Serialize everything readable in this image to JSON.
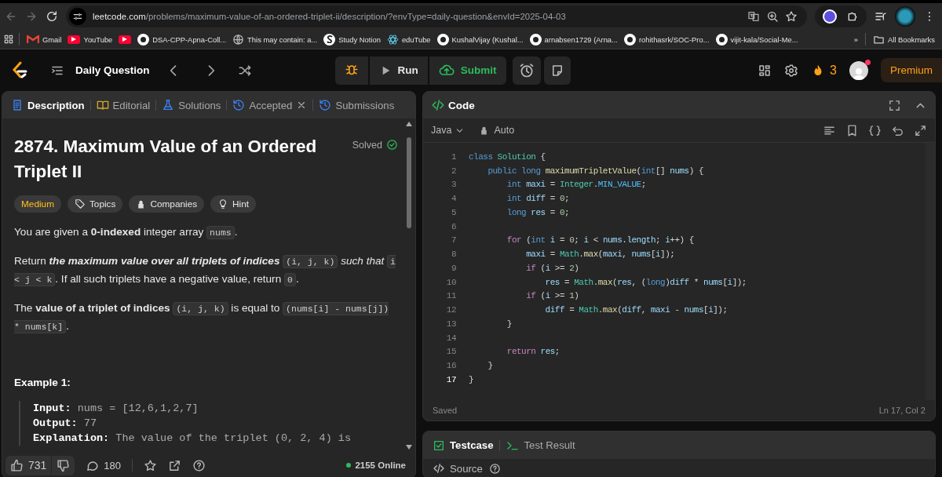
{
  "browser": {
    "url_host": "leetcode.com",
    "url_path": "/problems/maximum-value-of-an-ordered-triplet-ii/description/?envType=daily-question&envId=2025-04-03"
  },
  "bookmarks": [
    {
      "kind": "gmail",
      "label": "Gmail"
    },
    {
      "kind": "youtube",
      "label": "YouTube"
    },
    {
      "kind": "youtube"
    },
    {
      "kind": "github",
      "label": "DSA-CPP-Apna-Coll..."
    },
    {
      "kind": "globe",
      "label": "This may contain: a..."
    },
    {
      "kind": "notion",
      "label": "Study Notion"
    },
    {
      "kind": "react",
      "label": "eduTube"
    },
    {
      "kind": "github",
      "label": "KushalVijay (Kushal..."
    },
    {
      "kind": "github",
      "label": "arnabsen1729 (Arna..."
    },
    {
      "kind": "github",
      "label": "rohithasrk/SOC-Pro..."
    },
    {
      "kind": "github",
      "label": "vijit-kala/Social-Me..."
    }
  ],
  "more_bookmarks": "»",
  "all_bookmarks": "All Bookmarks",
  "nav": {
    "title": "Daily Question",
    "run": "Run",
    "submit": "Submit",
    "streak": "3",
    "premium": "Premium"
  },
  "left_tabs": [
    {
      "kind": "description",
      "label": "Description",
      "selected": true,
      "closable": false
    },
    {
      "kind": "editorial",
      "label": "Editorial",
      "selected": false,
      "closable": false
    },
    {
      "kind": "solutions",
      "label": "Solutions",
      "selected": false,
      "closable": false
    },
    {
      "kind": "history",
      "label": "Accepted",
      "selected": false,
      "closable": true
    },
    {
      "kind": "history",
      "label": "Submissions",
      "selected": false,
      "closable": false
    }
  ],
  "problem": {
    "title": "2874. Maximum Value of an Ordered Triplet II",
    "status": "Solved",
    "difficulty": "Medium",
    "tags": [
      {
        "kind": "topics",
        "label": "Topics"
      },
      {
        "kind": "companies",
        "label": "Companies"
      },
      {
        "kind": "hint",
        "label": "Hint"
      }
    ],
    "paragraphs": [
      [
        {
          "kind": "text",
          "text": "You are given a **0-indexed** integer array "
        },
        {
          "kind": "code",
          "text": "nums"
        },
        {
          "kind": "text",
          "text": "."
        }
      ],
      [
        {
          "kind": "text",
          "text": "Return "
        },
        {
          "kind": "emph",
          "text": "the maximum value over all triplets of indices "
        },
        {
          "kind": "code",
          "text": "(i, j, k)"
        },
        {
          "kind": "italic",
          "text": " such that "
        },
        {
          "kind": "code",
          "text": "i < j < k"
        },
        {
          "kind": "text",
          "text": ". If all such triplets have a negative value, return "
        },
        {
          "kind": "code",
          "text": "0"
        },
        {
          "kind": "text",
          "text": "."
        }
      ],
      [
        {
          "kind": "text",
          "text": "The **value of a triplet of indices** "
        },
        {
          "kind": "code",
          "text": "(i, j, k)"
        },
        {
          "kind": "text",
          "text": " is equal to "
        },
        {
          "kind": "code",
          "text": "(nums[i] - nums[j]) * nums[k]"
        },
        {
          "kind": "text",
          "text": "."
        }
      ]
    ],
    "example_title": "Example 1:",
    "example_lines": [
      {
        "label": "Input:",
        "value": "nums = [12,6,1,2,7]"
      },
      {
        "label": "Output:",
        "value": "77"
      },
      {
        "label": "Explanation:",
        "value": "The value of the triplet (0, 2, 4) is"
      }
    ]
  },
  "footer": {
    "likes": "731",
    "comments": "180",
    "online": "2155 Online"
  },
  "code_panel": {
    "title": "Code",
    "language": "Java",
    "mode": "Auto",
    "lines": [
      {
        "number": "1",
        "selected": false,
        "tokens": [
          {
            "text": "class ",
            "kind": "kw"
          },
          {
            "text": "Solution",
            "kind": "type"
          },
          {
            "text": " {",
            "kind": "p"
          }
        ]
      },
      {
        "number": "2",
        "selected": false,
        "tokens": [
          {
            "text": "    public long ",
            "kind": "kw"
          },
          {
            "text": "maximumTripletValue",
            "kind": "fn"
          },
          {
            "text": "(",
            "kind": "p"
          },
          {
            "text": "int",
            "kind": "kw"
          },
          {
            "text": "[] ",
            "kind": "p"
          },
          {
            "text": "nums",
            "kind": "var"
          },
          {
            "text": ") {",
            "kind": "p"
          }
        ]
      },
      {
        "number": "3",
        "selected": false,
        "tokens": [
          {
            "text": "        int ",
            "kind": "kw"
          },
          {
            "text": "maxi",
            "kind": "var"
          },
          {
            "text": " = ",
            "kind": "p"
          },
          {
            "text": "Integer",
            "kind": "type"
          },
          {
            "text": ".",
            "kind": "p"
          },
          {
            "text": "MIN_VALUE",
            "kind": "const"
          },
          {
            "text": ";",
            "kind": "p"
          }
        ]
      },
      {
        "number": "4",
        "selected": false,
        "tokens": [
          {
            "text": "        int ",
            "kind": "kw"
          },
          {
            "text": "diff",
            "kind": "var"
          },
          {
            "text": " = ",
            "kind": "p"
          },
          {
            "text": "0",
            "kind": "num"
          },
          {
            "text": ";",
            "kind": "p"
          }
        ]
      },
      {
        "number": "5",
        "selected": false,
        "tokens": [
          {
            "text": "        long ",
            "kind": "kw"
          },
          {
            "text": "res",
            "kind": "var"
          },
          {
            "text": " = ",
            "kind": "p"
          },
          {
            "text": "0",
            "kind": "num"
          },
          {
            "text": ";",
            "kind": "p"
          }
        ]
      },
      {
        "number": "6",
        "selected": false
      },
      {
        "number": "7",
        "selected": false,
        "tokens": [
          {
            "text": "        for",
            "kind": "ctl"
          },
          {
            "text": " (",
            "kind": "p"
          },
          {
            "text": "int ",
            "kind": "kw"
          },
          {
            "text": "i",
            "kind": "var"
          },
          {
            "text": " = ",
            "kind": "p"
          },
          {
            "text": "0",
            "kind": "num"
          },
          {
            "text": "; ",
            "kind": "p"
          },
          {
            "text": "i",
            "kind": "var"
          },
          {
            "text": " < ",
            "kind": "p"
          },
          {
            "text": "nums",
            "kind": "var"
          },
          {
            "text": ".",
            "kind": "p"
          },
          {
            "text": "length",
            "kind": "var"
          },
          {
            "text": "; ",
            "kind": "p"
          },
          {
            "text": "i",
            "kind": "var"
          },
          {
            "text": "++) {",
            "kind": "p"
          }
        ]
      },
      {
        "number": "8",
        "selected": false,
        "tokens": [
          {
            "text": "            maxi",
            "kind": "var"
          },
          {
            "text": " = ",
            "kind": "p"
          },
          {
            "text": "Math",
            "kind": "type"
          },
          {
            "text": ".",
            "kind": "p"
          },
          {
            "text": "max",
            "kind": "fn"
          },
          {
            "text": "(",
            "kind": "p"
          },
          {
            "text": "maxi",
            "kind": "var"
          },
          {
            "text": ", ",
            "kind": "p"
          },
          {
            "text": "nums",
            "kind": "var"
          },
          {
            "text": "[",
            "kind": "p"
          },
          {
            "text": "i",
            "kind": "var"
          },
          {
            "text": "]);",
            "kind": "p"
          }
        ]
      },
      {
        "number": "9",
        "selected": false,
        "tokens": [
          {
            "text": "            if",
            "kind": "ctl"
          },
          {
            "text": " (",
            "kind": "p"
          },
          {
            "text": "i",
            "kind": "var"
          },
          {
            "text": " >= ",
            "kind": "p"
          },
          {
            "text": "2",
            "kind": "num"
          },
          {
            "text": ")",
            "kind": "p"
          }
        ]
      },
      {
        "number": "10",
        "selected": false,
        "tokens": [
          {
            "text": "                res",
            "kind": "var"
          },
          {
            "text": " = ",
            "kind": "p"
          },
          {
            "text": "Math",
            "kind": "type"
          },
          {
            "text": ".",
            "kind": "p"
          },
          {
            "text": "max",
            "kind": "fn"
          },
          {
            "text": "(",
            "kind": "p"
          },
          {
            "text": "res",
            "kind": "var"
          },
          {
            "text": ", (",
            "kind": "p"
          },
          {
            "text": "long",
            "kind": "kw"
          },
          {
            "text": ")",
            "kind": "p"
          },
          {
            "text": "diff",
            "kind": "var"
          },
          {
            "text": " * ",
            "kind": "p"
          },
          {
            "text": "nums",
            "kind": "var"
          },
          {
            "text": "[",
            "kind": "p"
          },
          {
            "text": "i",
            "kind": "var"
          },
          {
            "text": "]);",
            "kind": "p"
          }
        ]
      },
      {
        "number": "11",
        "selected": false,
        "tokens": [
          {
            "text": "            if",
            "kind": "ctl"
          },
          {
            "text": " (",
            "kind": "p"
          },
          {
            "text": "i",
            "kind": "var"
          },
          {
            "text": " >= ",
            "kind": "p"
          },
          {
            "text": "1",
            "kind": "num"
          },
          {
            "text": ")",
            "kind": "p"
          }
        ]
      },
      {
        "number": "12",
        "selected": false,
        "tokens": [
          {
            "text": "                diff",
            "kind": "var"
          },
          {
            "text": " = ",
            "kind": "p"
          },
          {
            "text": "Math",
            "kind": "type"
          },
          {
            "text": ".",
            "kind": "p"
          },
          {
            "text": "max",
            "kind": "fn"
          },
          {
            "text": "(",
            "kind": "p"
          },
          {
            "text": "diff",
            "kind": "var"
          },
          {
            "text": ", ",
            "kind": "p"
          },
          {
            "text": "maxi",
            "kind": "var"
          },
          {
            "text": " - ",
            "kind": "p"
          },
          {
            "text": "nums",
            "kind": "var"
          },
          {
            "text": "[",
            "kind": "p"
          },
          {
            "text": "i",
            "kind": "var"
          },
          {
            "text": "]);",
            "kind": "p"
          }
        ]
      },
      {
        "number": "13",
        "selected": false,
        "tokens": [
          {
            "text": "        }",
            "kind": "p"
          }
        ]
      },
      {
        "number": "14",
        "selected": false
      },
      {
        "number": "15",
        "selected": false,
        "tokens": [
          {
            "text": "        return ",
            "kind": "ctl"
          },
          {
            "text": "res",
            "kind": "var"
          },
          {
            "text": ";",
            "kind": "p"
          }
        ]
      },
      {
        "number": "16",
        "selected": false,
        "tokens": [
          {
            "text": "    }",
            "kind": "p"
          }
        ]
      },
      {
        "number": "17",
        "selected": true,
        "tokens": [
          {
            "text": "}",
            "kind": "p"
          }
        ]
      }
    ]
  },
  "status": {
    "saved": "Saved",
    "cursor": "Ln 17, Col 2"
  },
  "bottom_tabs": [
    {
      "kind": "testcase",
      "label": "Testcase",
      "selected": true
    },
    {
      "kind": "result",
      "label": "Test Result",
      "selected": false
    }
  ],
  "source": "Source"
}
